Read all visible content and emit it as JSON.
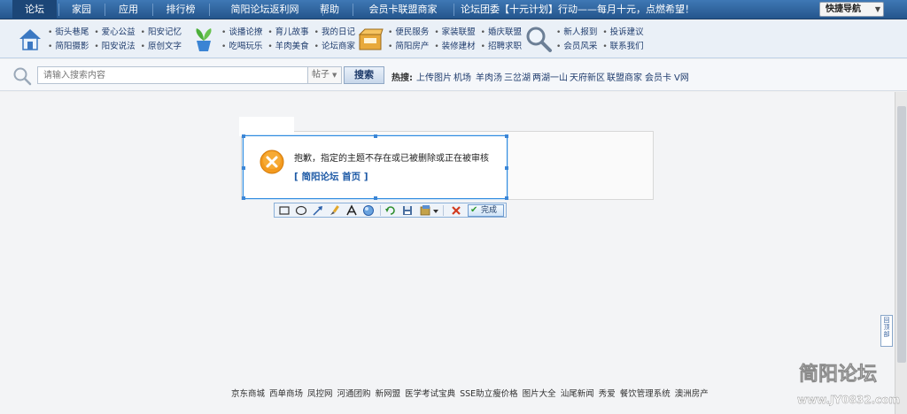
{
  "nav": {
    "items": [
      "论坛",
      "家园",
      "应用",
      "排行榜",
      "简阳论坛返利网",
      "帮助",
      "会员卡联盟商家",
      "论坛团委【十元计划】行动——每月十元，点燃希望！"
    ],
    "quick_nav": "快捷导航"
  },
  "categories": [
    {
      "icon": "house-icon",
      "links": [
        "街头巷尾",
        "爱心公益",
        "阳安记忆",
        "简阳摄影",
        "阳安说法",
        "原创文字"
      ]
    },
    {
      "icon": "plant-icon",
      "links": [
        "谈播论撩",
        "育儿故事",
        "我的日记",
        "吃喝玩乐",
        "羊肉美食",
        "论坛商家"
      ]
    },
    {
      "icon": "box-icon",
      "links": [
        "便民服务",
        "家装联盟",
        "婚庆联盟",
        "简阳房产",
        "装修建材",
        "招聘求职"
      ]
    },
    {
      "icon": "magnifier-icon",
      "links": [
        "新人报到",
        "投诉建议",
        "会员风采",
        "联系我们"
      ]
    }
  ],
  "search": {
    "placeholder": "请输入搜索内容",
    "type": "帖子",
    "button": "搜索",
    "hot_label": "热搜:",
    "hot_links": [
      "上传图片",
      "机场",
      "羊肉汤",
      "三岔湖",
      "两湖一山",
      "天府新区",
      "联盟商家",
      "会员卡",
      "V网"
    ]
  },
  "dialog": {
    "message": "抱歉，指定的主题不存在或已被删除或正在被审核",
    "link": "[ 简阳论坛 首页 ]"
  },
  "toolbar": {
    "tools": [
      "rectangle-icon",
      "ellipse-icon",
      "arrow-icon",
      "brush-icon",
      "text-icon",
      "mosaic-icon",
      "undo-icon",
      "save-icon",
      "copy-icon",
      "cancel-icon"
    ],
    "done": "完成"
  },
  "footer": {
    "links": [
      "京东商城",
      "西单商场",
      "凤控网",
      "河通团购",
      "新网盟",
      "医学考试宝典",
      "SSE助立瘦价格",
      "图片大全",
      "汕尾新闻",
      "秀爱",
      "餐饮管理系统",
      "澳洲房产"
    ]
  },
  "back_to_top": "回顶部",
  "watermark": {
    "title": "简阳论坛",
    "url": "www.JY0832.com"
  },
  "colors": {
    "nav_blue": "#2d5f98",
    "dialog_border": "#2e8be0",
    "error_orange": "#f39a1e",
    "link_blue": "#1e5aa6"
  }
}
